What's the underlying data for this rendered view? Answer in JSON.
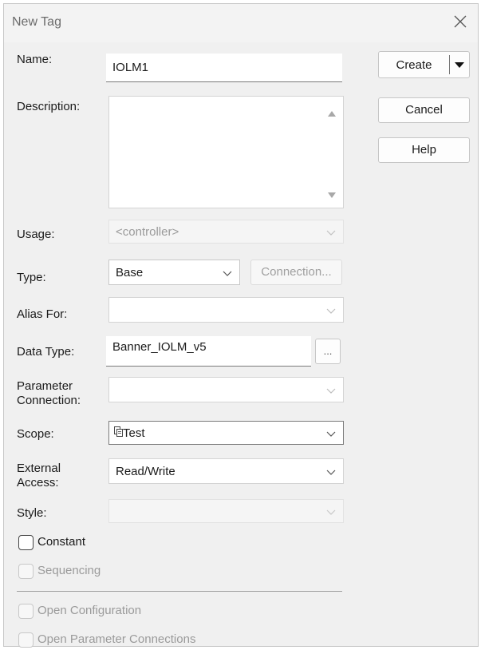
{
  "window": {
    "title": "New Tag"
  },
  "buttons": {
    "create": "Create",
    "cancel": "Cancel",
    "help": "Help",
    "connection": "Connection...",
    "browse": "..."
  },
  "form": {
    "name_label": "Name:",
    "name_value": "IOLM1",
    "description_label": "Description:",
    "description_value": "",
    "usage_label": "Usage:",
    "usage_value": "<controller>",
    "type_label": "Type:",
    "type_value": "Base",
    "alias_label": "Alias For:",
    "alias_value": "",
    "datatype_label": "Data Type:",
    "datatype_value": "Banner_IOLM_v5",
    "param_label_1": "Parameter",
    "param_label_2": "Connection:",
    "param_value": "",
    "scope_label": "Scope:",
    "scope_value": "Test",
    "access_label_1": "External",
    "access_label_2": "Access:",
    "access_value": "Read/Write",
    "style_label": "Style:",
    "style_value": ""
  },
  "checkboxes": {
    "constant": {
      "label": "Constant",
      "checked": false
    },
    "sequencing": {
      "label": "Sequencing",
      "checked": false
    },
    "open_configuration": {
      "label": "Open Configuration",
      "checked": false
    },
    "open_parameter_connections": {
      "label": "Open Parameter Connections",
      "checked": false
    }
  },
  "icons": [
    "close-icon",
    "chevron-down-icon",
    "dropdown-arrow-icon",
    "scroll-up-icon",
    "scroll-down-icon",
    "program-scope-icon"
  ]
}
